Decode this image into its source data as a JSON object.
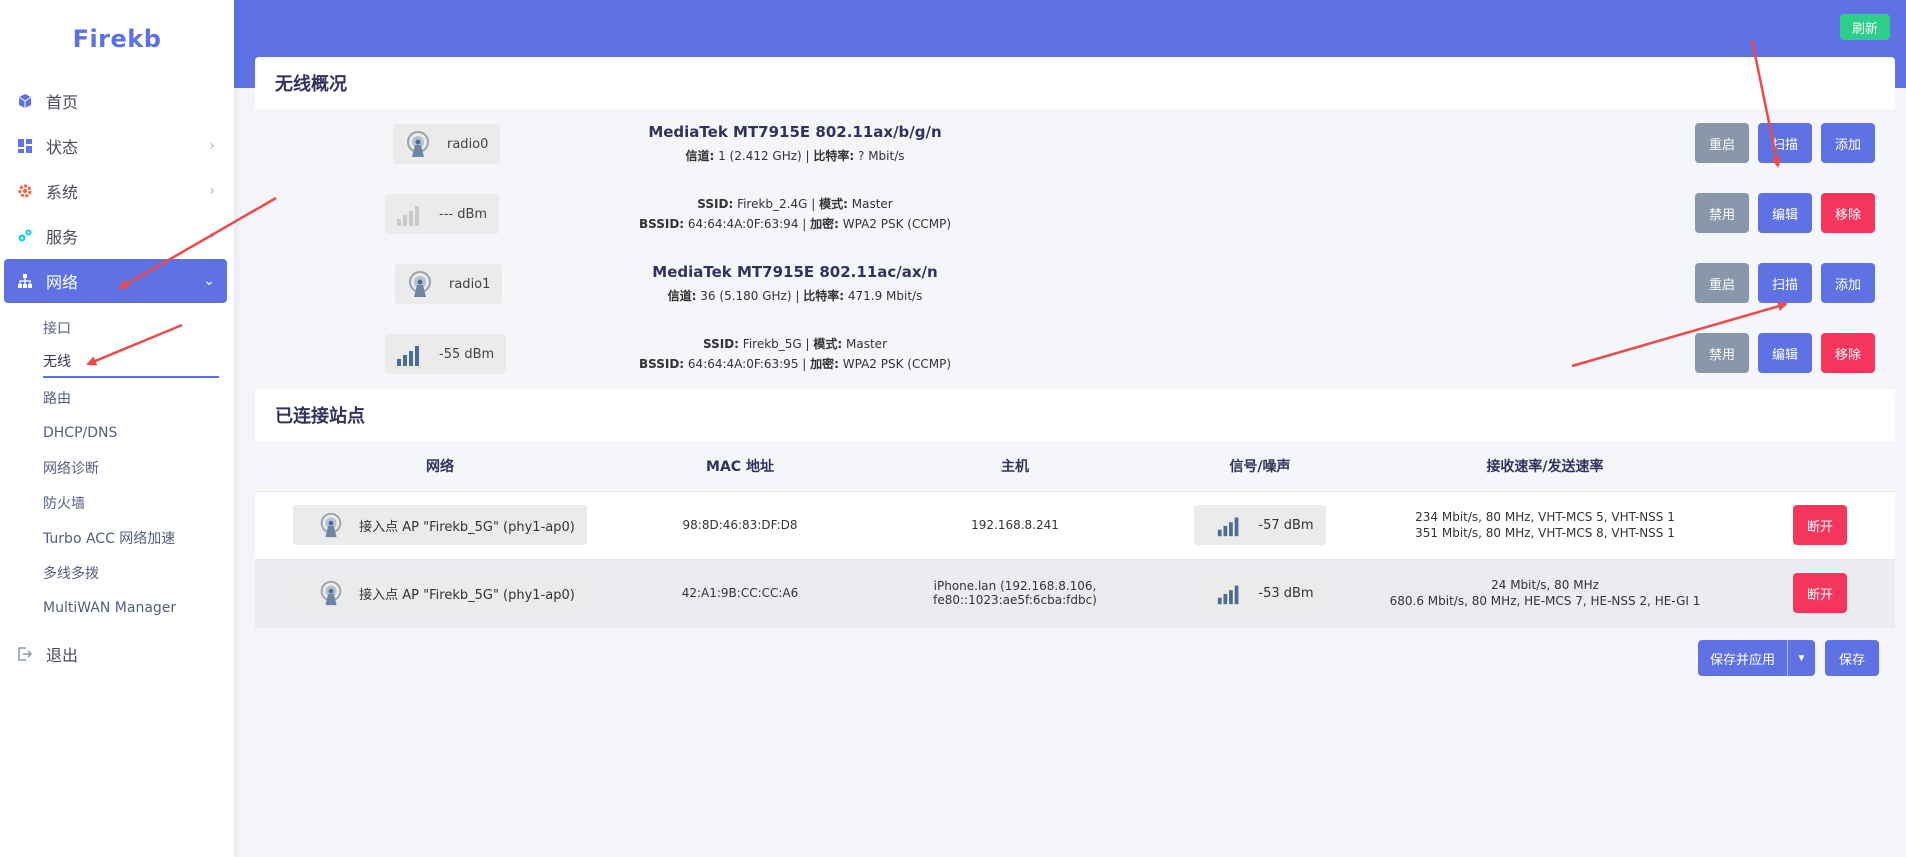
{
  "brand": "Firekb",
  "nav": {
    "home": "首页",
    "status": "状态",
    "system": "系统",
    "services": "服务",
    "network": "网络",
    "logout": "退出",
    "sub": [
      "接口",
      "无线",
      "路由",
      "DHCP/DNS",
      "网络诊断",
      "防火墙",
      "Turbo ACC 网络加速",
      "多线多拨",
      "MultiWAN Manager"
    ]
  },
  "topbar": {
    "refresh": "刷新"
  },
  "wireless": {
    "title": "无线概况",
    "radios": [
      {
        "name": "radio0",
        "chip": "MediaTek MT7915E 802.11ax/b/g/n",
        "ch_label": "信道:",
        "ch_value": " 1 (2.412 GHz) | ",
        "rate_label": "比特率:",
        "rate_value": " ? Mbit/s",
        "btn_restart": "重启",
        "btn_scan": "扫描",
        "btn_add": "添加",
        "net": {
          "signal": "--- dBm",
          "ssid_label": "SSID:",
          "ssid_value": " Firekb_2.4G | ",
          "mode_label": "模式:",
          "mode_value": " Master",
          "bssid_label": "BSSID:",
          "bssid_value": " 64:64:4A:0F:63:94 | ",
          "enc_label": "加密:",
          "enc_value": " WPA2 PSK (CCMP)",
          "btn_disable": "禁用",
          "btn_edit": "编辑",
          "btn_remove": "移除"
        }
      },
      {
        "name": "radio1",
        "chip": "MediaTek MT7915E 802.11ac/ax/n",
        "ch_label": "信道:",
        "ch_value": " 36 (5.180 GHz) | ",
        "rate_label": "比特率:",
        "rate_value": " 471.9 Mbit/s",
        "btn_restart": "重启",
        "btn_scan": "扫描",
        "btn_add": "添加",
        "net": {
          "signal": "-55 dBm",
          "ssid_label": "SSID:",
          "ssid_value": " Firekb_5G | ",
          "mode_label": "模式:",
          "mode_value": " Master",
          "bssid_label": "BSSID:",
          "bssid_value": " 64:64:4A:0F:63:95 | ",
          "enc_label": "加密:",
          "enc_value": " WPA2 PSK (CCMP)",
          "btn_disable": "禁用",
          "btn_edit": "编辑",
          "btn_remove": "移除"
        }
      }
    ]
  },
  "stations": {
    "title": "已连接站点",
    "headers": [
      "网络",
      "MAC 地址",
      "主机",
      "信号/噪声",
      "接收速率/发送速率"
    ],
    "rows": [
      {
        "network": "接入点 AP \"Firekb_5G\" (phy1-ap0)",
        "mac": "98:8D:46:83:DF:D8",
        "host": "192.168.8.241",
        "signal": "-57 dBm",
        "rx": "234 Mbit/s, 80 MHz, VHT-MCS 5, VHT-NSS 1",
        "tx": "351 Mbit/s, 80 MHz, VHT-MCS 8, VHT-NSS 1",
        "btn": "断开"
      },
      {
        "network": "接入点 AP \"Firekb_5G\" (phy1-ap0)",
        "mac": "42:A1:9B:CC:CC:A6",
        "host": "iPhone.lan (192.168.8.106, fe80::1023:ae5f:6cba:fdbc)",
        "signal": "-53 dBm",
        "rx": "24 Mbit/s, 80 MHz",
        "tx": "680.6 Mbit/s, 80 MHz, HE-MCS 7, HE-NSS 2, HE-GI 1",
        "btn": "断开"
      }
    ]
  },
  "footer": {
    "save_apply": "保存并应用",
    "save": "保存"
  },
  "colors": {
    "accent": "#5e72e4",
    "danger": "#f5365c",
    "success": "#2dce89",
    "neutral": "#8898aa"
  }
}
